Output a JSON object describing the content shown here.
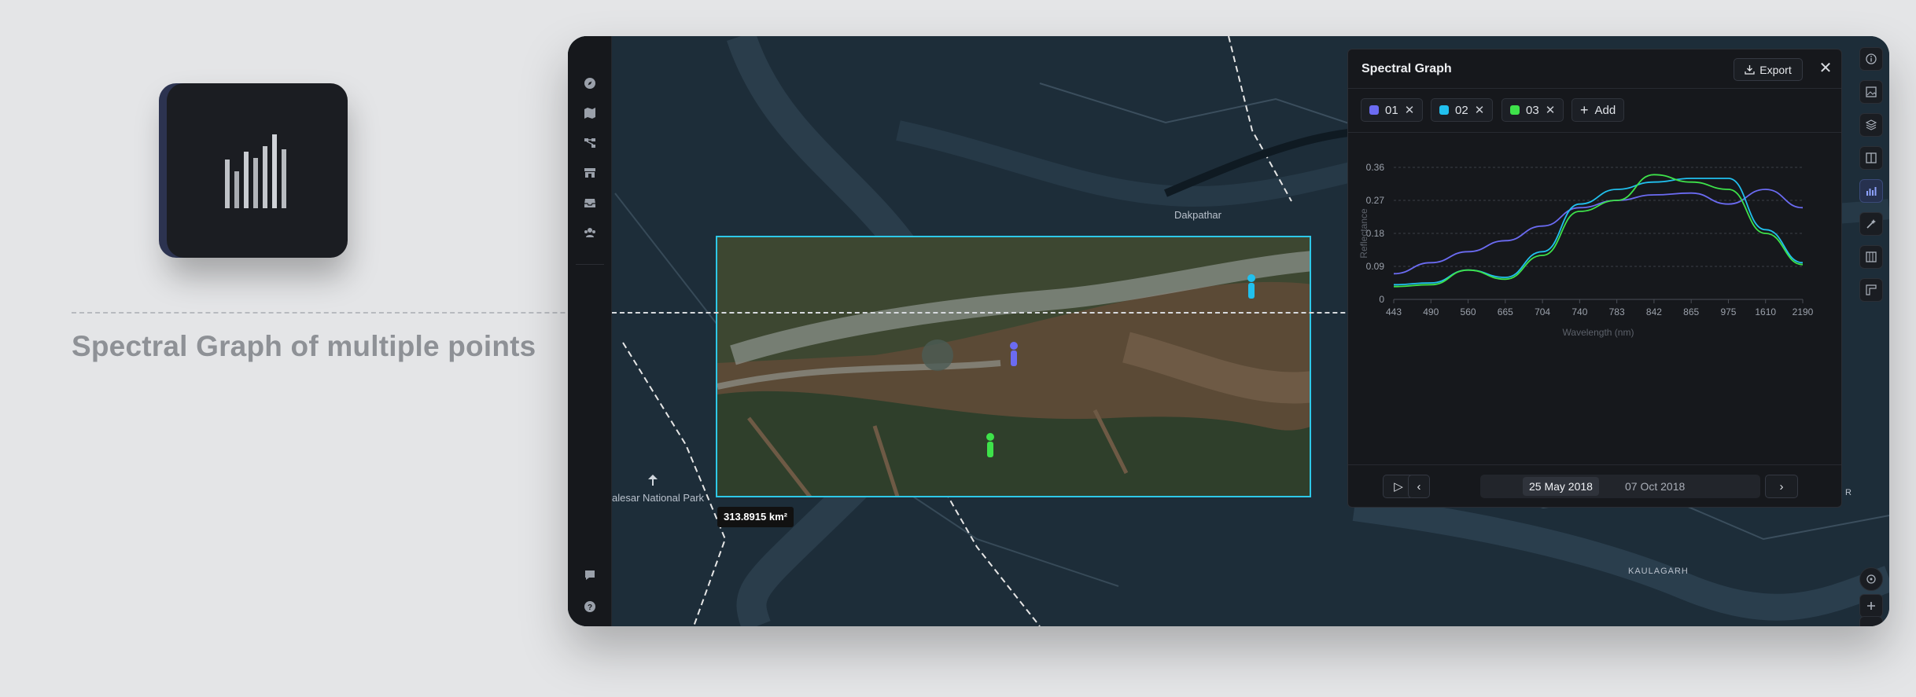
{
  "feature": {
    "caption": "Spectral Graph of multiple points",
    "icon": "bar-chart-icon"
  },
  "map": {
    "place_labels": [
      "Dakpathar",
      "alesar National Park",
      "KAULAGARH",
      "R"
    ],
    "area_label": "313.8915 km²"
  },
  "left_rail": {
    "icons": [
      "compass-icon",
      "map-icon",
      "nodes-icon",
      "store-icon",
      "inbox-icon",
      "users-icon",
      "chat-icon",
      "help-icon"
    ]
  },
  "right_rail": {
    "icons": [
      "info-icon",
      "image-icon",
      "layers-icon",
      "split-view-icon",
      "spectral-chart-icon",
      "magic-icon",
      "map-book-icon",
      "ruler-icon"
    ],
    "active": "spectral-chart-icon",
    "zoom_icons": [
      "locate-icon",
      "zoom-in-icon",
      "zoom-out-icon"
    ]
  },
  "panel": {
    "title": "Spectral Graph",
    "export_label": "Export",
    "close_symbol": "✕",
    "chips": [
      {
        "label": "01",
        "color": "#6b6bf2"
      },
      {
        "label": "02",
        "color": "#21c0ee"
      },
      {
        "label": "03",
        "color": "#3ee24a"
      }
    ],
    "add_label": "Add",
    "dates": {
      "selected": "25 May 2018",
      "other": "07 Oct 2018"
    }
  },
  "chart_data": {
    "type": "line",
    "xlabel": "Wavelength (nm)",
    "ylabel": "Reflectance",
    "categories": [
      "443",
      "490",
      "560",
      "665",
      "704",
      "740",
      "783",
      "842",
      "865",
      "975",
      "1610",
      "2190"
    ],
    "yticks": [
      "0",
      "0.09",
      "0.18",
      "0.27",
      "0.36"
    ],
    "ylim": [
      0,
      0.36
    ],
    "grid": true,
    "series": [
      {
        "name": "01",
        "color": "#6b6bf2",
        "values": [
          0.07,
          0.1,
          0.13,
          0.16,
          0.2,
          0.25,
          0.27,
          0.285,
          0.29,
          0.26,
          0.3,
          0.25
        ]
      },
      {
        "name": "02",
        "color": "#21c0ee",
        "values": [
          0.04,
          0.045,
          0.08,
          0.06,
          0.13,
          0.26,
          0.3,
          0.32,
          0.33,
          0.33,
          0.19,
          0.1
        ]
      },
      {
        "name": "03",
        "color": "#3ee24a",
        "values": [
          0.035,
          0.04,
          0.08,
          0.055,
          0.12,
          0.24,
          0.27,
          0.34,
          0.32,
          0.3,
          0.18,
          0.095
        ]
      }
    ]
  }
}
